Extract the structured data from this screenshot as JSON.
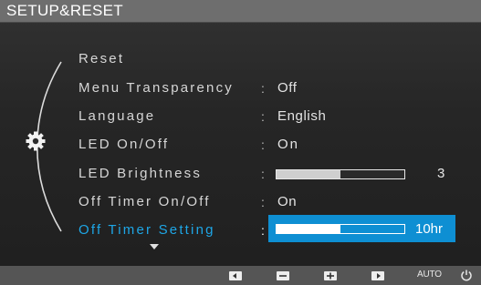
{
  "title": "SETUP&RESET",
  "menu": [
    {
      "label": "Reset",
      "value": ""
    },
    {
      "label": "Menu Transparency",
      "value": "Off"
    },
    {
      "label": "Language",
      "value": "English"
    },
    {
      "label": "LED On/Off",
      "value": "On"
    },
    {
      "label": "LED Brightness",
      "value": "3",
      "level": 0.5
    },
    {
      "label": "Off Timer On/Off",
      "value": "On"
    },
    {
      "label": "Off Timer Setting",
      "value": "10hr",
      "level": 0.5
    }
  ],
  "selected_item": "Off Timer Setting",
  "separator": ":",
  "more_indicator": "scroll-down-arrow",
  "footer": {
    "buttons": [
      "left-arrow-icon",
      "minus-icon",
      "plus-icon",
      "right-arrow-icon"
    ],
    "auto_label": "AUTO",
    "power_icon": "power-icon"
  },
  "colors": {
    "title_bar": "#6e6e6e",
    "selection": "#0e8fd3",
    "selected_text": "#1ea6e6",
    "text": "#d6d6d6"
  }
}
